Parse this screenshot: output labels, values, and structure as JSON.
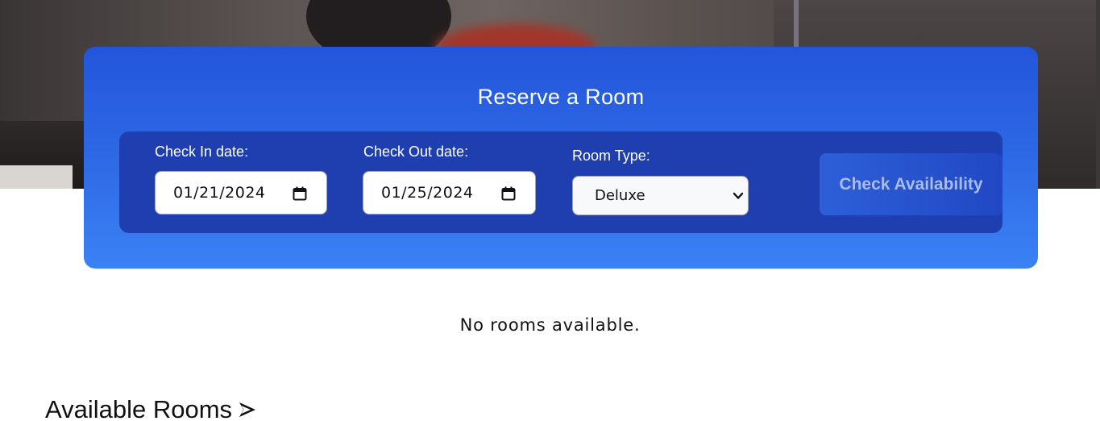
{
  "booking": {
    "title": "Reserve a Room",
    "check_in": {
      "label": "Check In date:",
      "value": "01/21/2024"
    },
    "check_out": {
      "label": "Check Out date:",
      "value": "01/25/2024"
    },
    "room_type": {
      "label": "Room Type:",
      "selected": "Deluxe"
    },
    "submit_label": "Check Availability"
  },
  "results": {
    "message": "No rooms available."
  },
  "section": {
    "title": "Available Rooms"
  },
  "colors": {
    "card_top": "#2355db",
    "card_bottom": "#3b82f4",
    "panel": "#1f3fb0",
    "button_text": "#a9bbe8"
  },
  "icons": [
    "calendar-icon",
    "chevron-down-icon",
    "arrow-right-icon"
  ]
}
